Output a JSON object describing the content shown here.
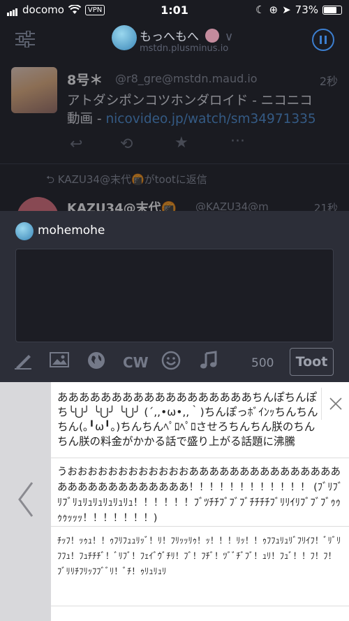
{
  "status_bar": {
    "carrier": "docomo",
    "vpn": "VPN",
    "time": "1:01",
    "battery": "73%",
    "battery_level": 0.73
  },
  "header": {
    "account_name": "もっへもへ",
    "instance": "mstdn.plusminus.io"
  },
  "post": {
    "display_name": "8号＊",
    "handle": "@r8_gre@mstdn.maud.io",
    "time": "2秒",
    "text_line1": "アトダシポンコツホンダロイド - ニコニコ",
    "text_prefix": "動画 - ",
    "link": "nicovideo.jp/watch/sm34971335"
  },
  "boost_notice": {
    "text": "KAZU34@末代🍘がtootに返信"
  },
  "post2": {
    "display_name": "KAZU34@末代🍘",
    "handle": "@KAZU34@m",
    "time": "21秒"
  },
  "composer": {
    "username": "mohemohe",
    "text": "",
    "cw_label": "CW",
    "char_count": "500",
    "toot_label": "Toot"
  },
  "suggestions": {
    "items": [
      {
        "text": "ああああああああああああああああああちんぽちんぽち╰⋃╯ ╰⋃╯ ╰⋃╯ (´,,•ω•,,｀)ちんぽっﾎﾞｲﾝｯちんちんちん(｡╹ω╹｡)ちんちんﾍﾟﾛﾍﾟﾛさせろちんちん朕のちんちん朕の料金がかかる話で盛り上がる話題に沸騰"
      },
      {
        "text": "うおおおおおおおおおおおおああああああああああああああああああああああああああああ！！！！！！！！！！！！ (ﾌﾞﾘﾌﾞﾘﾌﾞﾘｭﾘｭﾘｭﾘｭﾘｭﾘｭ！！！！！！ﾌﾞﾂﾁﾁﾌﾞﾌﾞﾌﾞﾁﾁﾁﾁﾌﾞﾘﾘｲﾘﾌﾞﾌﾞﾌﾞｩｩｩｩｯｯｯ！！！！！！！)"
      },
      {
        "text": "ﾁｯﾌ！ｯｩｭ！！ｩﾌﾘﾌｭｭﾘｯﾞ！ﾘ！ﾌﾘｯｯﾘｩ！ｯ！！！ﾘｯ！！ｩﾌﾌｭﾘｭﾘﾞﾌﾘｲﾌ！ﾞﾘﾞﾘﾌﾌｭ！ﾌｭﾁﾁﾁﾞ！ﾞﾘﾌﾞ！ﾌｪｲﾞｳﾞﾁﾘ！ﾌﾞ！ﾌﾁﾞ！ﾂﾞﾞﾁﾞﾌﾞ！ｭﾘ！ﾌｭﾞ！！ﾌ！ﾌ！ﾌﾞﾘﾘﾁﾌﾘｯﾌﾌﾞﾞﾘ！ﾞﾁ！ｩﾘｭﾘｭﾘ"
      }
    ]
  },
  "colors": {
    "background": "#1a1b21",
    "composer_bg": "#2c2e38",
    "accent": "#4a8fd6",
    "muted": "#747988"
  }
}
